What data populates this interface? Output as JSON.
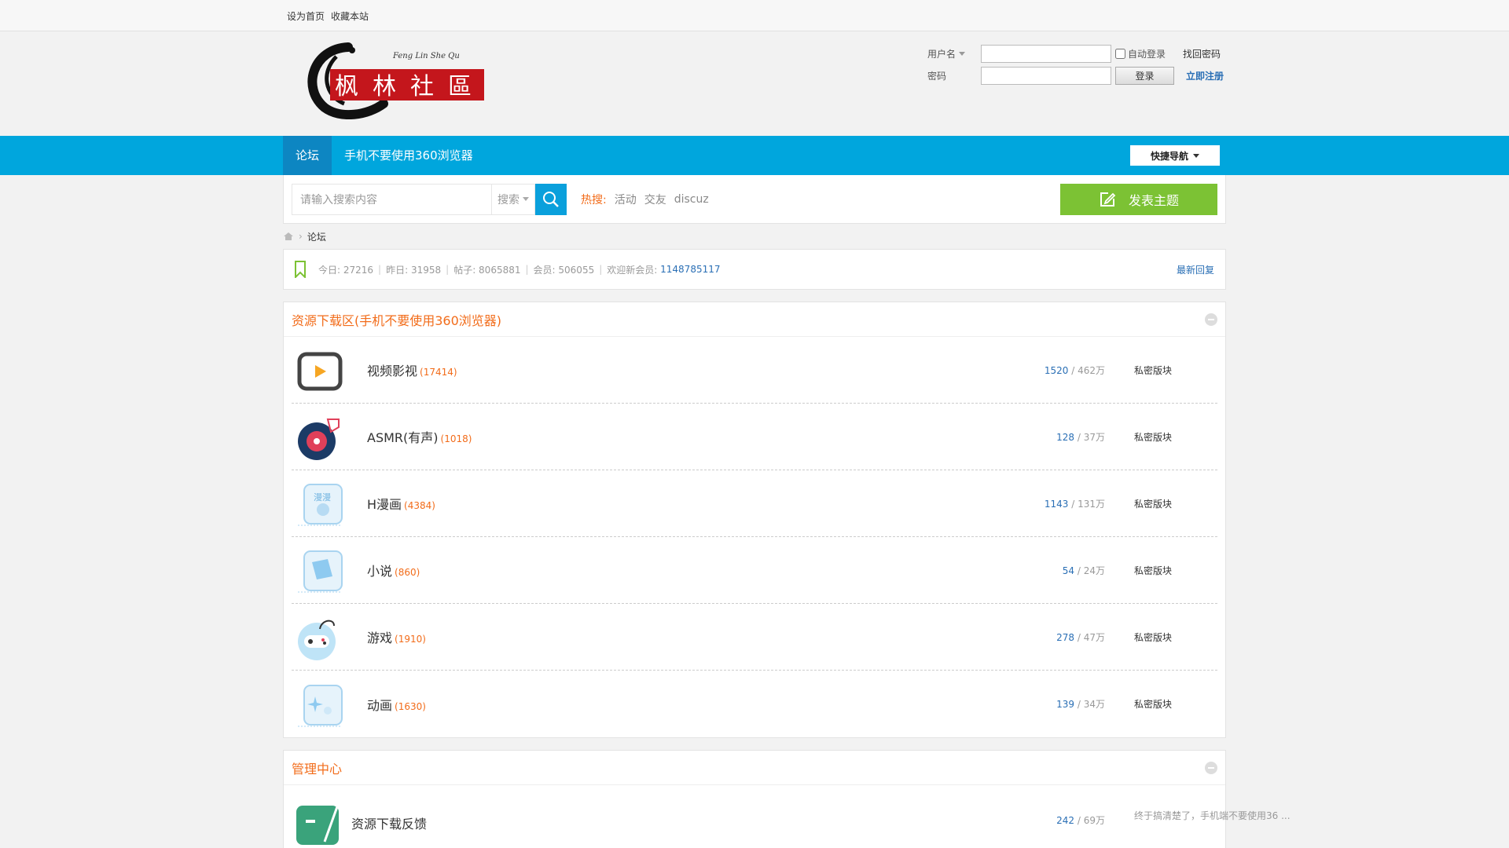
{
  "topbar": {
    "set_home": "设为首页",
    "bookmark": "收藏本站"
  },
  "logo": {
    "tagline": "Feng Lin She Qu",
    "chars": [
      "枫",
      "林",
      "社",
      "區"
    ]
  },
  "login": {
    "username_label": "用户名",
    "password_label": "密码",
    "auto_login": "自动登录",
    "login_btn": "登录",
    "forgot": "找回密码",
    "register": "立即注册"
  },
  "nav": {
    "forum_tab": "论坛",
    "notice_tab": "手机不要使用360浏览器",
    "quick_nav": "快捷导航"
  },
  "search": {
    "placeholder": "请输入搜索内容",
    "type": "搜索",
    "hot_label": "热搜:",
    "hot": [
      "活动",
      "交友",
      "discuz"
    ],
    "post_btn": "发表主题"
  },
  "breadcrumb": {
    "current": "论坛"
  },
  "stats": {
    "today": "今日: 27216",
    "yesterday": "昨日: 31958",
    "posts": "帖子: 8065881",
    "members": "会员: 506055",
    "welcome_label": "欢迎新会员:",
    "new_member": "1148785117",
    "latest": "最新回复"
  },
  "sections": [
    {
      "title": "资源下载区(手机不要使用360浏览器)",
      "forums": [
        {
          "name": "视频影视",
          "count": "(17414)",
          "threads": "1520",
          "posts": "462万",
          "last": "私密版块",
          "icon": "video-play-icon"
        },
        {
          "name": "ASMR(有声)",
          "count": "(1018)",
          "threads": "128",
          "posts": "37万",
          "last": "私密版块",
          "icon": "vinyl-record-icon"
        },
        {
          "name": "H漫画",
          "count": "(4384)",
          "threads": "1143",
          "posts": "131万",
          "last": "私密版块",
          "icon": "comic-icon"
        },
        {
          "name": "小说",
          "count": "(860)",
          "threads": "54",
          "posts": "24万",
          "last": "私密版块",
          "icon": "book-icon"
        },
        {
          "name": "游戏",
          "count": "(1910)",
          "threads": "278",
          "posts": "47万",
          "last": "私密版块",
          "icon": "gamepad-icon"
        },
        {
          "name": "动画",
          "count": "(1630)",
          "threads": "139",
          "posts": "34万",
          "last": "私密版块",
          "icon": "sparkle-icon"
        }
      ]
    },
    {
      "title": "管理中心",
      "forums": [
        {
          "name": "资源下载反馈",
          "count": "",
          "threads": "242",
          "posts": "69万",
          "last": "终于搞清楚了，手机端不要使用36 ...",
          "icon": "feedback-icon"
        }
      ]
    }
  ],
  "colors": {
    "nav": "#00a6dd",
    "nav_active": "#0d86c2",
    "accent_orange": "#f26c1a",
    "post_green": "#7cc234",
    "link_blue": "#2a6fb5"
  }
}
